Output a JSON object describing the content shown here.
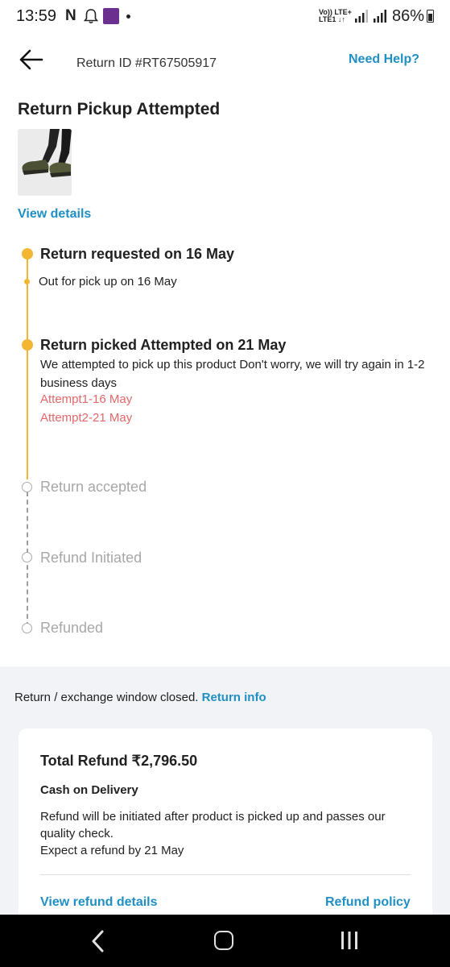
{
  "status_bar": {
    "time": "13:59",
    "n_icon_text": "N",
    "volte_top": "Vo)) LTE+",
    "volte_bottom": "LTE1 ↓↑",
    "battery": "86%"
  },
  "header": {
    "return_id": "Return ID #RT67505917",
    "help_link": "Need Help?"
  },
  "page_title": "Return Pickup Attempted",
  "product": {
    "view_details": "View details"
  },
  "timeline": {
    "requested": "Return requested on 16 May",
    "out_for_pickup": "Out for pick up on 16 May",
    "attempted": "Return picked Attempted on 21 May",
    "attempted_desc": "We attempted to pick up this product Don't worry, we will try again in 1-2 business days",
    "attempt1": "Attempt1-16 May",
    "attempt2": "Attempt2-21 May",
    "accepted": "Return accepted",
    "refund_initiated": "Refund Initiated",
    "refunded": "Refunded"
  },
  "window": {
    "text": "Return / exchange window closed.",
    "link": "Return info"
  },
  "refund": {
    "total": "Total Refund ₹2,796.50",
    "method": "Cash on Delivery",
    "note_line1": "Refund will be initiated after product is picked up and passes our quality check.",
    "note_line2": "Expect a refund by 21 May",
    "view_refund_details": "View refund details",
    "refund_policy": "Refund policy"
  },
  "colors": {
    "accent_blue": "#1f8fc4",
    "timeline_yellow": "#f2b632",
    "attempt_red": "#e5676b",
    "pending_grey": "#a8a8a8"
  },
  "icons": [
    "back-arrow-icon",
    "bell-icon",
    "signal-icon",
    "battery-icon",
    "nav-back-icon",
    "nav-home-icon",
    "nav-recents-icon"
  ]
}
